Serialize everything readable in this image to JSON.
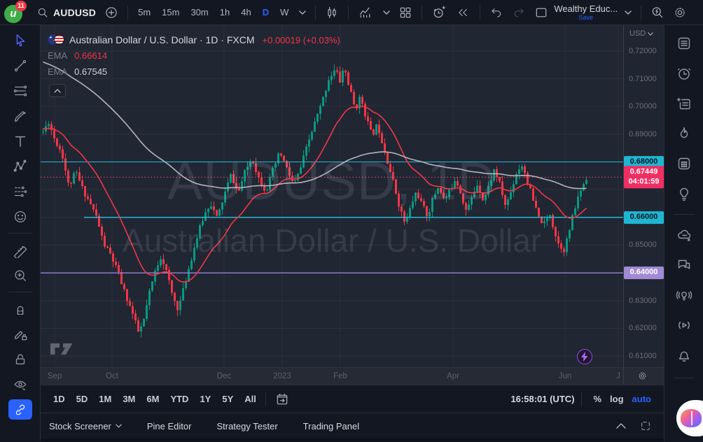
{
  "topbar": {
    "logo_badge": "11",
    "symbol": "AUDUSD",
    "intervals": [
      "5m",
      "15m",
      "30m",
      "1h",
      "4h",
      "D",
      "W"
    ],
    "active_interval": "D",
    "layout_name": "Wealthy Educ...",
    "save_label": "Save"
  },
  "chart": {
    "legend": {
      "title": "Australian Dollar / U.S. Dollar · 1D · FXCM",
      "change": "+0.00019 (+0.03%)",
      "indicators": [
        {
          "label": "EMA",
          "value": "0.66614",
          "color": "#f23645"
        },
        {
          "label": "EMA",
          "value": "0.67545",
          "color": "#d1d4dc"
        }
      ]
    },
    "watermark": {
      "line1": "AUDUSD, 1D",
      "line2": "Australian Dollar / U.S. Dollar"
    },
    "price_scale": {
      "currency": "USD",
      "ticks": [
        {
          "text": "0.72000",
          "price": 0.72
        },
        {
          "text": "0.71000",
          "price": 0.71
        },
        {
          "text": "0.70000",
          "price": 0.7
        },
        {
          "text": "0.69000",
          "price": 0.69
        },
        {
          "text": "0.65000",
          "price": 0.65
        },
        {
          "text": "0.63000",
          "price": 0.63
        },
        {
          "text": "0.62000",
          "price": 0.62
        },
        {
          "text": "0.61000",
          "price": 0.61
        }
      ],
      "badges": [
        {
          "text": "0.68000",
          "price": 0.68,
          "bg": "#1fb6d1",
          "fg": "#0c1724"
        },
        {
          "text": "0.67449",
          "sub": "04:01:59",
          "price": 0.67449,
          "bg": "#ef2e63",
          "fg": "#ffffff"
        },
        {
          "text": "0.66000",
          "price": 0.66,
          "bg": "#1fb6d1",
          "fg": "#0c1724"
        },
        {
          "text": "0.64000",
          "price": 0.64,
          "bg": "#a18bd4",
          "fg": "#ffffff"
        }
      ]
    },
    "time_axis": {
      "labels": [
        {
          "text": "Sep",
          "x": 20
        },
        {
          "text": "Oct",
          "x": 102
        },
        {
          "text": "Dec",
          "x": 262
        },
        {
          "text": "2023",
          "x": 345
        },
        {
          "text": "Feb",
          "x": 428
        },
        {
          "text": "Apr",
          "x": 589
        },
        {
          "text": "Jun",
          "x": 749
        },
        {
          "text": "J",
          "x": 825
        }
      ]
    }
  },
  "chart_data": {
    "type": "candlestick",
    "title": "AUDUSD 1D FXCM",
    "symbol": "AUDUSD",
    "timeframe": "1D",
    "exchange": "FXCM",
    "last_price": 0.67449,
    "countdown": "04:01:59",
    "change_abs": "+0.00019",
    "change_pct": "+0.03%",
    "ylim": [
      0.606,
      0.7293
    ],
    "grid_prices": [
      0.61,
      0.62,
      0.63,
      0.64,
      0.65,
      0.66,
      0.67,
      0.68,
      0.69,
      0.7,
      0.71,
      0.72
    ],
    "x_labels": [
      "Sep",
      "Oct",
      "Dec",
      "2023",
      "Feb",
      "Apr",
      "Jun",
      "J"
    ],
    "candle_count": 195,
    "seed": 11,
    "price_keyframes": [
      [
        0.0,
        0.691
      ],
      [
        0.0103,
        0.6945
      ],
      [
        0.0218,
        0.688
      ],
      [
        0.0346,
        0.6835
      ],
      [
        0.0474,
        0.671
      ],
      [
        0.0603,
        0.6765
      ],
      [
        0.0731,
        0.67
      ],
      [
        0.0859,
        0.6655
      ],
      [
        0.0987,
        0.66
      ],
      [
        0.1115,
        0.6505
      ],
      [
        0.1244,
        0.6465
      ],
      [
        0.1372,
        0.6405
      ],
      [
        0.15,
        0.633
      ],
      [
        0.1628,
        0.6265
      ],
      [
        0.1756,
        0.6185
      ],
      [
        0.1846,
        0.622
      ],
      [
        0.1949,
        0.632
      ],
      [
        0.2077,
        0.6415
      ],
      [
        0.2179,
        0.6465
      ],
      [
        0.2282,
        0.6395
      ],
      [
        0.2385,
        0.6315
      ],
      [
        0.2487,
        0.627
      ],
      [
        0.259,
        0.6345
      ],
      [
        0.2692,
        0.6425
      ],
      [
        0.2821,
        0.652
      ],
      [
        0.2949,
        0.66
      ],
      [
        0.3077,
        0.6655
      ],
      [
        0.3205,
        0.6595
      ],
      [
        0.3333,
        0.668
      ],
      [
        0.3462,
        0.6755
      ],
      [
        0.359,
        0.6685
      ],
      [
        0.3718,
        0.6765
      ],
      [
        0.3846,
        0.6815
      ],
      [
        0.3974,
        0.674
      ],
      [
        0.4103,
        0.6695
      ],
      [
        0.4231,
        0.677
      ],
      [
        0.4359,
        0.6835
      ],
      [
        0.4487,
        0.6775
      ],
      [
        0.4615,
        0.6715
      ],
      [
        0.4744,
        0.678
      ],
      [
        0.4872,
        0.6865
      ],
      [
        0.5,
        0.694
      ],
      [
        0.5128,
        0.701
      ],
      [
        0.5256,
        0.71
      ],
      [
        0.5385,
        0.7135
      ],
      [
        0.5462,
        0.709
      ],
      [
        0.5538,
        0.7145
      ],
      [
        0.5641,
        0.7065
      ],
      [
        0.5744,
        0.699
      ],
      [
        0.5846,
        0.7035
      ],
      [
        0.5949,
        0.696
      ],
      [
        0.6051,
        0.6895
      ],
      [
        0.6154,
        0.6935
      ],
      [
        0.6256,
        0.6865
      ],
      [
        0.6359,
        0.679
      ],
      [
        0.6462,
        0.6715
      ],
      [
        0.6564,
        0.6635
      ],
      [
        0.6667,
        0.6575
      ],
      [
        0.6769,
        0.664
      ],
      [
        0.6872,
        0.6695
      ],
      [
        0.6974,
        0.6645
      ],
      [
        0.7077,
        0.6605
      ],
      [
        0.7179,
        0.667
      ],
      [
        0.7282,
        0.6715
      ],
      [
        0.7385,
        0.666
      ],
      [
        0.7487,
        0.6695
      ],
      [
        0.759,
        0.6745
      ],
      [
        0.7692,
        0.6685
      ],
      [
        0.7795,
        0.662
      ],
      [
        0.7897,
        0.6675
      ],
      [
        0.8,
        0.6725
      ],
      [
        0.8103,
        0.666
      ],
      [
        0.8205,
        0.6715
      ],
      [
        0.8308,
        0.6775
      ],
      [
        0.841,
        0.6715
      ],
      [
        0.8513,
        0.664
      ],
      [
        0.8615,
        0.6695
      ],
      [
        0.8718,
        0.6765
      ],
      [
        0.8821,
        0.679
      ],
      [
        0.8923,
        0.6725
      ],
      [
        0.9026,
        0.6655
      ],
      [
        0.9128,
        0.6595
      ],
      [
        0.9231,
        0.6575
      ],
      [
        0.9333,
        0.6615
      ],
      [
        0.941,
        0.655
      ],
      [
        0.9487,
        0.6505
      ],
      [
        0.959,
        0.6485
      ],
      [
        0.9667,
        0.6535
      ],
      [
        0.9744,
        0.66
      ],
      [
        0.9821,
        0.6655
      ],
      [
        0.9897,
        0.67
      ],
      [
        1.0,
        0.6745
      ]
    ],
    "overlays": [
      {
        "name": "EMA fast",
        "period": 22,
        "last_value": 0.66614,
        "color": "#f23645"
      },
      {
        "name": "EMA slow",
        "period": 110,
        "last_value": 0.67545,
        "color": "#b2b5be"
      }
    ],
    "levels": [
      {
        "price": 0.68,
        "color": "#25b9d3",
        "x_start_frac": 0
      },
      {
        "price": 0.66,
        "color": "#25b9d3",
        "x_start_frac": 0.0745
      },
      {
        "price": 0.64,
        "color": "#8e79ce",
        "x_start_frac": 0
      }
    ]
  },
  "bottom_toolbar": {
    "ranges": [
      "1D",
      "5D",
      "1M",
      "3M",
      "6M",
      "YTD",
      "1Y",
      "5Y",
      "All"
    ],
    "clock": "16:58:01 (UTC)",
    "percent_label": "%",
    "log_label": "log",
    "auto_label": "auto"
  },
  "bottom_panel": {
    "tabs": [
      "Stock Screener",
      "Pine Editor",
      "Strategy Tester",
      "Trading Panel"
    ]
  },
  "colors": {
    "up": "#089981",
    "down": "#f23645",
    "accent": "#2962ff",
    "price_line": "#f74f6f",
    "grid": "rgba(255,255,255,0.05)"
  }
}
